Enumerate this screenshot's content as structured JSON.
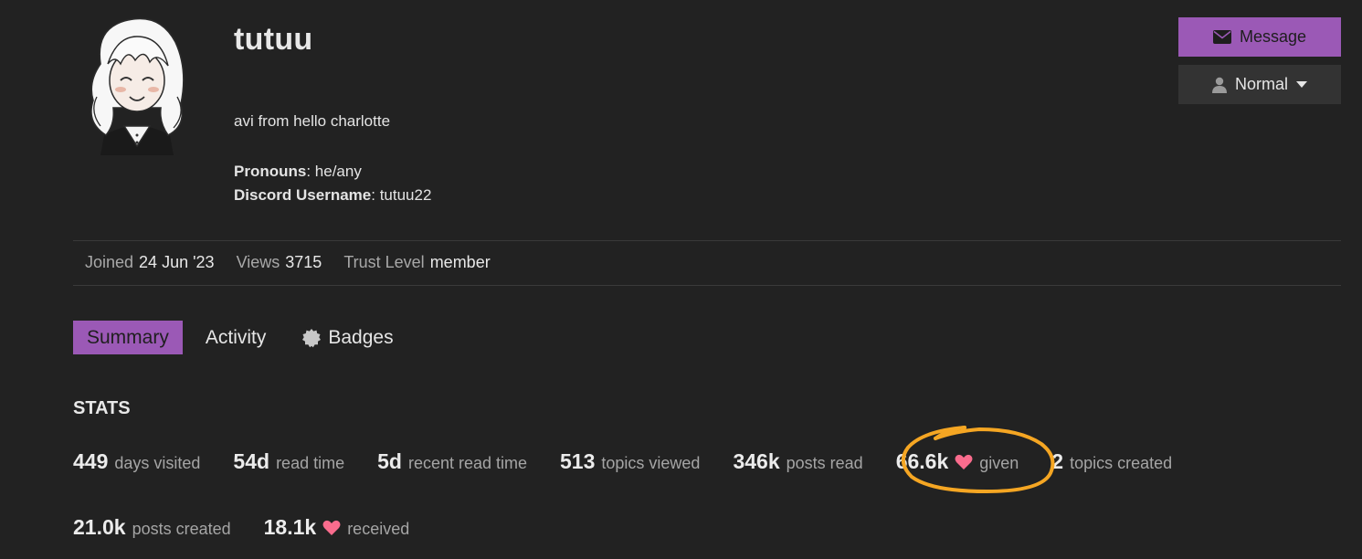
{
  "profile": {
    "username": "tutuu",
    "bio": "avi from hello charlotte",
    "fields": [
      {
        "label": "Pronouns",
        "value": "he/any"
      },
      {
        "label": "Discord Username",
        "value": "tutuu22"
      }
    ]
  },
  "actions": {
    "message_label": "Message",
    "notification_label": "Normal"
  },
  "meta": {
    "joined_label": "Joined",
    "joined_value": "24 Jun '23",
    "views_label": "Views",
    "views_value": "3715",
    "trust_label": "Trust Level",
    "trust_value": "member"
  },
  "tabs": [
    {
      "label": "Summary",
      "active": true
    },
    {
      "label": "Activity",
      "active": false
    },
    {
      "label": "Badges",
      "active": false
    }
  ],
  "stats": {
    "title": "STATS",
    "items": [
      {
        "num": "449",
        "desc": "days visited"
      },
      {
        "num": "54d",
        "desc": "read time"
      },
      {
        "num": "5d",
        "desc": "recent read time"
      },
      {
        "num": "513",
        "desc": "topics viewed"
      },
      {
        "num": "346k",
        "desc": "posts read"
      },
      {
        "num": "66.6k",
        "desc": "given"
      },
      {
        "num": "2",
        "desc": "topics created"
      },
      {
        "num": "21.0k",
        "desc": "posts created"
      },
      {
        "num": "18.1k",
        "desc": "received"
      }
    ]
  },
  "colors": {
    "accent": "#9b59b6",
    "heart": "#fa6c8d",
    "annotation": "#f5a623",
    "background": "#222222"
  }
}
